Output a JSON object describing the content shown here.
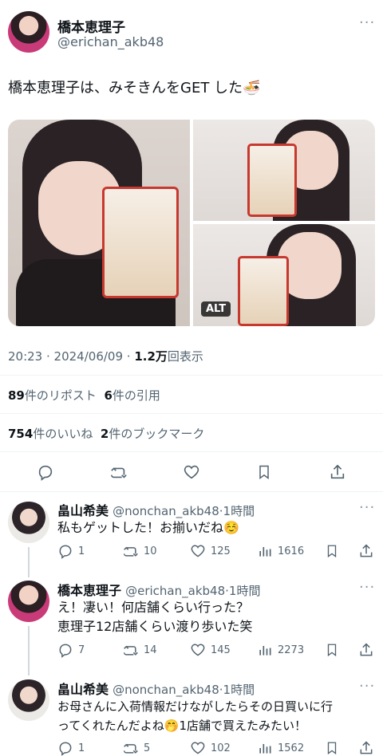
{
  "tweet": {
    "author_name": "橋本恵理子",
    "author_handle": "@erichan_akb48",
    "text": "橋本恵理子は、みそきんをGET した🍜",
    "alt_badge": "ALT",
    "time": "20:23",
    "date": "2024/06/09",
    "views_count": "1.2万",
    "views_label": "回表示",
    "reposts_count": "89",
    "reposts_label": "件のリポスト",
    "quotes_count": "6",
    "quotes_label": "件の引用",
    "likes_count": "754",
    "likes_label": "件のいいね",
    "bookmarks_count": "2",
    "bookmarks_label": "件のブックマーク"
  },
  "replies": [
    {
      "name": "畠山希美",
      "handle": "@nonchan_akb48",
      "time": "1時間",
      "lines": [
        "私もゲットした！お揃いだね☺️"
      ],
      "reply_count": "1",
      "repost_count": "10",
      "like_count": "125",
      "view_count": "1616"
    },
    {
      "name": "橋本恵理子",
      "handle": "@erichan_akb48",
      "time": "1時間",
      "lines": [
        "え！凄い！何店舗くらい行った？",
        "恵理子12店舗くらい渡り歩いた笑"
      ],
      "reply_count": "7",
      "repost_count": "14",
      "like_count": "145",
      "view_count": "2273"
    },
    {
      "name": "畠山希美",
      "handle": "@nonchan_akb48",
      "time": "1時間",
      "lines": [
        "お母さんに入荷情報だけながしたらその日買いに行",
        "ってくれたんだよね🤭1店舗で買えたみたい！"
      ],
      "reply_count": "1",
      "repost_count": "5",
      "like_count": "102",
      "view_count": "1562"
    }
  ],
  "colors": {
    "text": "#0f1419",
    "muted": "#536471",
    "divider": "#eff3f4",
    "thread": "#cfd9de"
  },
  "icons": [
    "more-icon",
    "reply-icon",
    "repost-icon",
    "like-icon",
    "bookmark-icon",
    "share-icon",
    "views-icon"
  ]
}
